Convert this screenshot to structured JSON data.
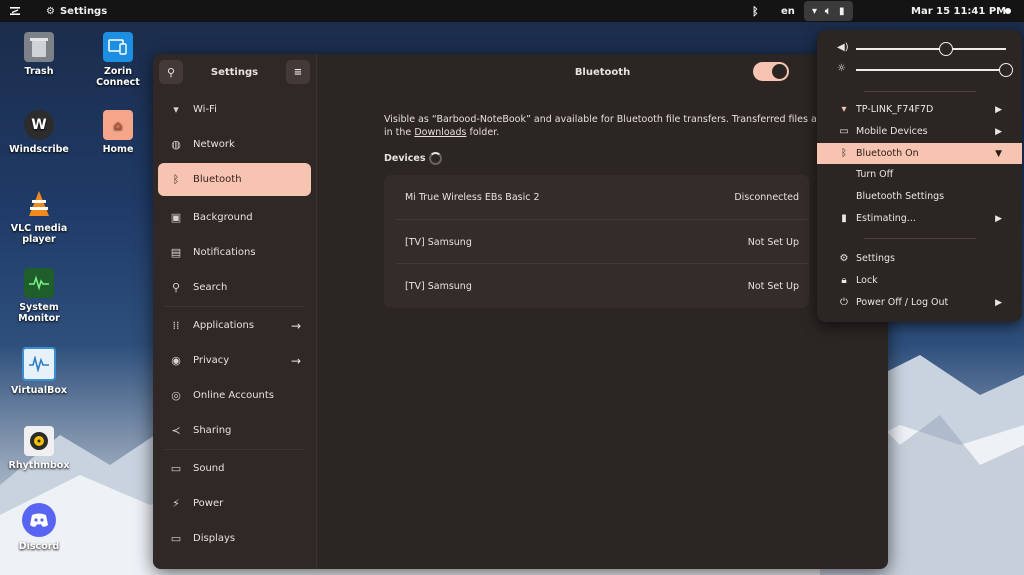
{
  "topbar": {
    "activities_icon": "zorin-menu-icon",
    "app_name": "Settings",
    "keyboard_layout": "en",
    "datetime": "Mar 15  11:41 PM"
  },
  "desktop": {
    "icons": [
      {
        "label": "Trash",
        "icon": "trash-icon"
      },
      {
        "label": "Zorin Connect",
        "icon": "zorin-connect-icon"
      },
      {
        "label": "Windscribe",
        "icon": "windscribe-icon"
      },
      {
        "label": "Home",
        "icon": "home-folder-icon"
      },
      {
        "label": "VLC media player",
        "icon": "vlc-icon"
      },
      {
        "label": "System Monitor",
        "icon": "system-monitor-icon"
      },
      {
        "label": "VirtualBox",
        "icon": "virtualbox-icon"
      },
      {
        "label": "Rhythmbox",
        "icon": "rhythmbox-icon"
      },
      {
        "label": "Discord",
        "icon": "discord-icon"
      }
    ]
  },
  "settings": {
    "sidebar_title": "Settings",
    "items": [
      {
        "label": "Wi-Fi",
        "icon": "wifi-icon"
      },
      {
        "label": "Network",
        "icon": "network-icon"
      },
      {
        "label": "Bluetooth",
        "icon": "bluetooth-icon"
      },
      {
        "label": "Background",
        "icon": "background-icon"
      },
      {
        "label": "Notifications",
        "icon": "notifications-icon"
      },
      {
        "label": "Search",
        "icon": "search-icon"
      },
      {
        "label": "Applications",
        "icon": "applications-icon"
      },
      {
        "label": "Privacy",
        "icon": "privacy-icon"
      },
      {
        "label": "Online Accounts",
        "icon": "online-accounts-icon"
      },
      {
        "label": "Sharing",
        "icon": "sharing-icon"
      },
      {
        "label": "Sound",
        "icon": "sound-icon"
      },
      {
        "label": "Power",
        "icon": "power-icon"
      },
      {
        "label": "Displays",
        "icon": "displays-icon"
      }
    ],
    "active_item": "Bluetooth",
    "page_title": "Bluetooth",
    "bluetooth_enabled": true,
    "description_prefix": "Visible as “Barbood-NoteBook” and available for Bluetooth file transfers. Transferred files are placed",
    "description_in": "in the",
    "description_link": "Downloads",
    "description_suffix": "folder.",
    "devices_label": "Devices",
    "devices": [
      {
        "name": "Mi True Wireless EBs Basic 2",
        "status": "Disconnected"
      },
      {
        "name": "[TV] Samsung",
        "status": "Not Set Up"
      },
      {
        "name": "[TV] Samsung",
        "status": "Not Set Up"
      }
    ]
  },
  "quick_menu": {
    "volume_level": 0.6,
    "brightness_level": 1.0,
    "wifi_label": "TP-LINK_F74F7D",
    "mobile_devices_label": "Mobile Devices",
    "bluetooth_label": "Bluetooth On",
    "bt_turn_off": "Turn Off",
    "bt_settings": "Bluetooth Settings",
    "battery_label": "Estimating...",
    "settings_label": "Settings",
    "lock_label": "Lock",
    "power_label": "Power Off / Log Out"
  },
  "colors": {
    "accent": "#f6c4b0",
    "window_bg": "#2b2523",
    "topbar_bg": "#141414"
  }
}
